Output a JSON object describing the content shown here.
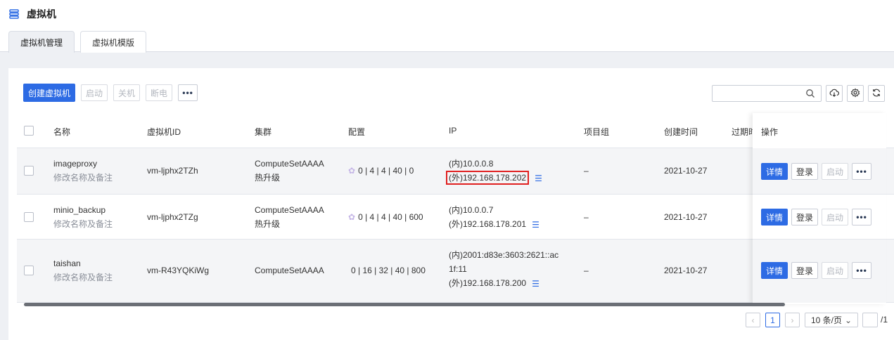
{
  "page": {
    "title": "虚拟机"
  },
  "tabs": [
    {
      "label": "虚拟机管理",
      "active": true
    },
    {
      "label": "虚拟机模版",
      "active": false
    }
  ],
  "toolbar": {
    "create_label": "创建虚拟机",
    "start_label": "启动",
    "shutdown_label": "关机",
    "poweroff_label": "断电",
    "more_label": "•••"
  },
  "search": {
    "placeholder": ""
  },
  "table": {
    "columns": [
      "名称",
      "虚拟机ID",
      "集群",
      "配置",
      "IP",
      "项目组",
      "创建时间",
      "过期时",
      "操作"
    ],
    "rows": [
      {
        "name": "imageproxy",
        "note": "修改名称及备注",
        "id": "vm-ljphx2TZh",
        "cluster": "ComputeSetAAAA",
        "cluster_tag": "热升级",
        "config": "0 | 4 | 4 | 40 | 0",
        "ip_internal": "(内)10.0.0.8",
        "ip_external": "(外)192.168.178.202",
        "project": "–",
        "created": "2021-10-27",
        "ops": {
          "detail": "详情",
          "login": "登录",
          "start": "启动",
          "more": "•••"
        }
      },
      {
        "name": "minio_backup",
        "note": "修改名称及备注",
        "id": "vm-ljphx2TZg",
        "cluster": "ComputeSetAAAA",
        "cluster_tag": "热升级",
        "config": "0 | 4 | 4 | 40 | 600",
        "ip_internal": "(内)10.0.0.7",
        "ip_external": "(外)192.168.178.201",
        "project": "–",
        "created": "2021-10-27",
        "ops": {
          "detail": "详情",
          "login": "登录",
          "start": "启动",
          "more": "•••"
        }
      },
      {
        "name": "taishan",
        "note": "修改名称及备注",
        "id": "vm-R43YQKiWg",
        "cluster": "ComputeSetAAAA",
        "cluster_tag": "",
        "config": "0 | 16 | 32 | 40 | 800",
        "ip_internal_line1": "(内)2001:d83e:3603:2621::ac",
        "ip_internal_line2": "1f:11",
        "ip_external": "(外)192.168.178.200",
        "project": "–",
        "created": "2021-10-27",
        "ops": {
          "detail": "详情",
          "login": "登录",
          "start": "启动",
          "more": "•••"
        }
      }
    ]
  },
  "pagination": {
    "current_page": "1",
    "page_size": "10 条/页",
    "total_pages_text": "/1"
  },
  "colors": {
    "accent": "#2d6be4",
    "highlight": "#e02020"
  }
}
